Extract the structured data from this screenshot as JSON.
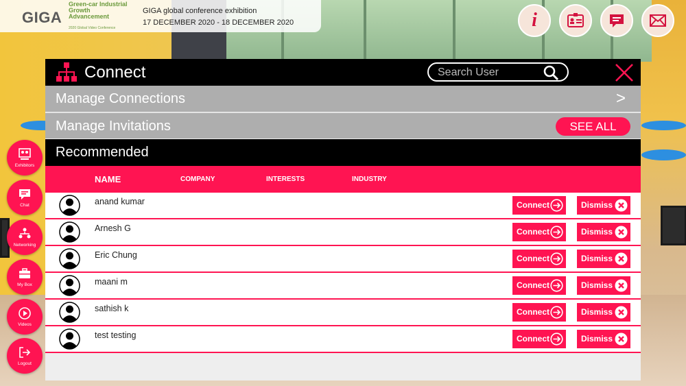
{
  "header": {
    "logo": "GIGA",
    "logo_sub": "Green-car Industrial Growth Advancement",
    "logo_mini": "2020 Global Video Conference",
    "title": "GIGA global conference exhibition",
    "dates": "17 DECEMBER 2020 - 18 DECEMBER 2020"
  },
  "top_icons": [
    "info-icon",
    "id-card-icon",
    "chat-bubble-icon",
    "mail-icon"
  ],
  "sidebar": {
    "items": [
      {
        "label": "Exhibitors",
        "icon": "exhibitors-icon"
      },
      {
        "label": "Chat",
        "icon": "chat-icon"
      },
      {
        "label": "Networking",
        "icon": "networking-icon"
      },
      {
        "label": "My Box",
        "icon": "briefcase-icon"
      },
      {
        "label": "Videos",
        "icon": "play-icon"
      },
      {
        "label": "Logout",
        "icon": "logout-icon"
      }
    ]
  },
  "modal": {
    "title": "Connect",
    "search_placeholder": "Search User",
    "manage_connections": "Manage Connections",
    "manage_connections_arrow": ">",
    "manage_invitations": "Manage Invitations",
    "see_all": "SEE ALL",
    "recommended": "Recommended",
    "columns": [
      "NAME",
      "COMPANY",
      "INTERESTS",
      "INDUSTRY"
    ],
    "connect_label": "Connect",
    "dismiss_label": "Dismiss",
    "users": [
      {
        "name": "anand kumar"
      },
      {
        "name": "Arnesh G"
      },
      {
        "name": "Eric Chung"
      },
      {
        "name": "maani m"
      },
      {
        "name": "sathish k"
      },
      {
        "name": "test testing"
      }
    ]
  },
  "colors": {
    "accent": "#ff1452",
    "header_bg": "#000000",
    "bar_bg": "#aeaeae"
  }
}
